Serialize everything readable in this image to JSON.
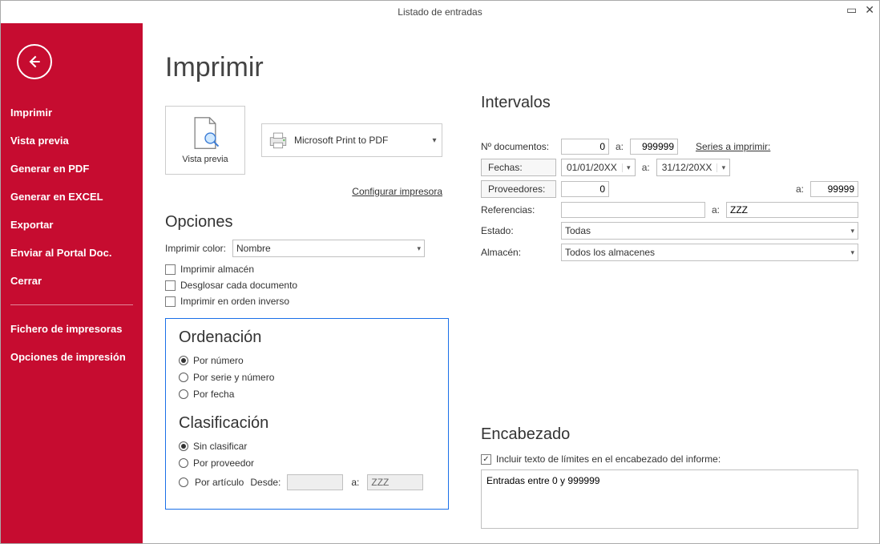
{
  "window": {
    "title": "Listado de entradas"
  },
  "page": {
    "title": "Imprimir"
  },
  "sidebar": {
    "items": [
      "Imprimir",
      "Vista previa",
      "Generar en PDF",
      "Generar en EXCEL",
      "Exportar",
      "Enviar al Portal Doc.",
      "Cerrar"
    ],
    "items2": [
      "Fichero de impresoras",
      "Opciones de impresión"
    ]
  },
  "preview_button": "Vista previa",
  "printer": {
    "name": "Microsoft Print to PDF"
  },
  "configure_printer": "Configurar impresora",
  "opciones": {
    "title": "Opciones",
    "color_label": "Imprimir color:",
    "color_value": "Nombre",
    "chk_almacen": "Imprimir almacén",
    "chk_desglosar": "Desglosar cada documento",
    "chk_inverso": "Imprimir en orden inverso"
  },
  "ordenacion": {
    "title": "Ordenación",
    "r1": "Por número",
    "r2": "Por serie y número",
    "r3": "Por fecha"
  },
  "clasificacion": {
    "title": "Clasificación",
    "r1": "Sin clasificar",
    "r2": "Por proveedor",
    "r3": "Por artículo",
    "desde": "Desde:",
    "a": "a:",
    "desde_val": "",
    "a_val": "ZZZ"
  },
  "intervalos": {
    "title": "Intervalos",
    "ndoc_label": "Nº documentos:",
    "ndoc_from": "0",
    "ndoc_to": "999999",
    "series_link": "Series a imprimir:",
    "fechas_button": "Fechas:",
    "fecha_from": "01/01/20XX",
    "fecha_to": "31/12/20XX",
    "prov_button": "Proveedores:",
    "prov_from": "0",
    "prov_to": "99999",
    "ref_label": "Referencias:",
    "ref_from": "",
    "ref_to": "ZZZ",
    "estado_label": "Estado:",
    "estado_value": "Todas",
    "almacen_label": "Almacén:",
    "almacen_value": "Todos los almacenes",
    "a": "a:"
  },
  "encabezado": {
    "title": "Encabezado",
    "chk_label": "Incluir texto de límites en el encabezado del informe:",
    "text": "Entradas entre 0 y 999999"
  }
}
